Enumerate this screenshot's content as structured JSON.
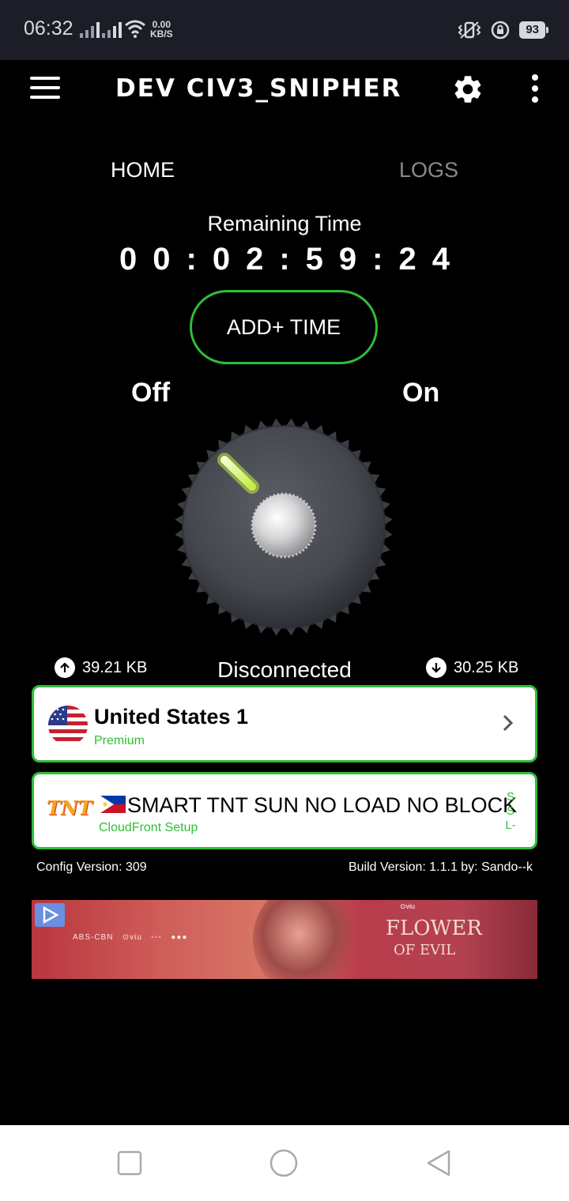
{
  "status_bar": {
    "time": "06:32",
    "net_speed_value": "0.00",
    "net_speed_unit": "KB/S",
    "battery": "93"
  },
  "app_bar": {
    "title": "DEV CIV3_SNIPHER",
    "menu_icon": "hamburger-icon",
    "settings_icon": "gear-icon",
    "overflow_icon": "more-vertical-icon"
  },
  "tabs": [
    {
      "label": "HOME",
      "active": true
    },
    {
      "label": "LOGS",
      "active": false
    }
  ],
  "timer": {
    "label": "Remaining Time",
    "value": "00:02:59:24"
  },
  "add_time_label": "ADD+ TIME",
  "switch": {
    "off_label": "Off",
    "on_label": "On",
    "state": "off"
  },
  "traffic": {
    "upload": "39.21 KB",
    "download": "30.25 KB",
    "status": "Disconnected"
  },
  "server": {
    "name": "United States 1",
    "tier": "Premium",
    "flag": "us-flag-icon"
  },
  "config": {
    "name": "SMART TNT SUN NO LOAD NO BLOCK",
    "subtitle": "CloudFront Setup",
    "logo_text": "TNT",
    "protocol": [
      "S",
      "S",
      "L-"
    ]
  },
  "footer": {
    "config_version": "Config Version: 309",
    "build_version": "Build Version: 1.1.1 by: Sando--k"
  },
  "ad": {
    "brand": "viu",
    "title_line1": "FLOWER",
    "title_line2": "OF EVIL"
  },
  "colors": {
    "accent_green": "#2fbe38",
    "background": "#000000",
    "status_bar": "#1d1d28"
  }
}
